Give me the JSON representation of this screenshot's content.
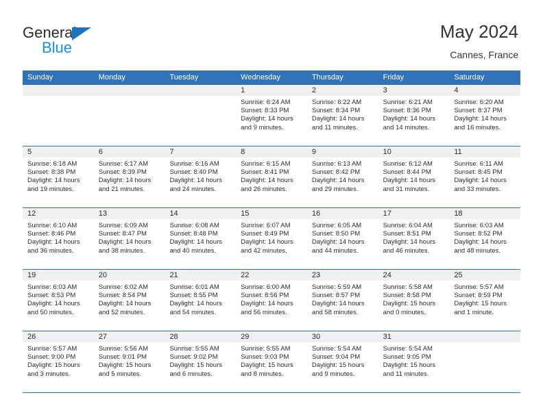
{
  "brand": {
    "name_part1": "General",
    "name_part2": "Blue"
  },
  "header": {
    "month_title": "May 2024",
    "location": "Cannes, France",
    "accent_color": "#3173b8",
    "band_color": "#f0f0f0"
  },
  "calendar": {
    "weekdays": [
      "Sunday",
      "Monday",
      "Tuesday",
      "Wednesday",
      "Thursday",
      "Friday",
      "Saturday"
    ],
    "weeks": [
      [
        {
          "day": "",
          "sunrise": "",
          "sunset": "",
          "daylight_line1": "",
          "daylight_line2": ""
        },
        {
          "day": "",
          "sunrise": "",
          "sunset": "",
          "daylight_line1": "",
          "daylight_line2": ""
        },
        {
          "day": "",
          "sunrise": "",
          "sunset": "",
          "daylight_line1": "",
          "daylight_line2": ""
        },
        {
          "day": "1",
          "sunrise": "Sunrise: 6:24 AM",
          "sunset": "Sunset: 8:33 PM",
          "daylight_line1": "Daylight: 14 hours",
          "daylight_line2": "and 9 minutes."
        },
        {
          "day": "2",
          "sunrise": "Sunrise: 6:22 AM",
          "sunset": "Sunset: 8:34 PM",
          "daylight_line1": "Daylight: 14 hours",
          "daylight_line2": "and 11 minutes."
        },
        {
          "day": "3",
          "sunrise": "Sunrise: 6:21 AM",
          "sunset": "Sunset: 8:36 PM",
          "daylight_line1": "Daylight: 14 hours",
          "daylight_line2": "and 14 minutes."
        },
        {
          "day": "4",
          "sunrise": "Sunrise: 6:20 AM",
          "sunset": "Sunset: 8:37 PM",
          "daylight_line1": "Daylight: 14 hours",
          "daylight_line2": "and 16 minutes."
        }
      ],
      [
        {
          "day": "5",
          "sunrise": "Sunrise: 6:18 AM",
          "sunset": "Sunset: 8:38 PM",
          "daylight_line1": "Daylight: 14 hours",
          "daylight_line2": "and 19 minutes."
        },
        {
          "day": "6",
          "sunrise": "Sunrise: 6:17 AM",
          "sunset": "Sunset: 8:39 PM",
          "daylight_line1": "Daylight: 14 hours",
          "daylight_line2": "and 21 minutes."
        },
        {
          "day": "7",
          "sunrise": "Sunrise: 6:16 AM",
          "sunset": "Sunset: 8:40 PM",
          "daylight_line1": "Daylight: 14 hours",
          "daylight_line2": "and 24 minutes."
        },
        {
          "day": "8",
          "sunrise": "Sunrise: 6:15 AM",
          "sunset": "Sunset: 8:41 PM",
          "daylight_line1": "Daylight: 14 hours",
          "daylight_line2": "and 26 minutes."
        },
        {
          "day": "9",
          "sunrise": "Sunrise: 6:13 AM",
          "sunset": "Sunset: 8:42 PM",
          "daylight_line1": "Daylight: 14 hours",
          "daylight_line2": "and 29 minutes."
        },
        {
          "day": "10",
          "sunrise": "Sunrise: 6:12 AM",
          "sunset": "Sunset: 8:44 PM",
          "daylight_line1": "Daylight: 14 hours",
          "daylight_line2": "and 31 minutes."
        },
        {
          "day": "11",
          "sunrise": "Sunrise: 6:11 AM",
          "sunset": "Sunset: 8:45 PM",
          "daylight_line1": "Daylight: 14 hours",
          "daylight_line2": "and 33 minutes."
        }
      ],
      [
        {
          "day": "12",
          "sunrise": "Sunrise: 6:10 AM",
          "sunset": "Sunset: 8:46 PM",
          "daylight_line1": "Daylight: 14 hours",
          "daylight_line2": "and 36 minutes."
        },
        {
          "day": "13",
          "sunrise": "Sunrise: 6:09 AM",
          "sunset": "Sunset: 8:47 PM",
          "daylight_line1": "Daylight: 14 hours",
          "daylight_line2": "and 38 minutes."
        },
        {
          "day": "14",
          "sunrise": "Sunrise: 6:08 AM",
          "sunset": "Sunset: 8:48 PM",
          "daylight_line1": "Daylight: 14 hours",
          "daylight_line2": "and 40 minutes."
        },
        {
          "day": "15",
          "sunrise": "Sunrise: 6:07 AM",
          "sunset": "Sunset: 8:49 PM",
          "daylight_line1": "Daylight: 14 hours",
          "daylight_line2": "and 42 minutes."
        },
        {
          "day": "16",
          "sunrise": "Sunrise: 6:05 AM",
          "sunset": "Sunset: 8:50 PM",
          "daylight_line1": "Daylight: 14 hours",
          "daylight_line2": "and 44 minutes."
        },
        {
          "day": "17",
          "sunrise": "Sunrise: 6:04 AM",
          "sunset": "Sunset: 8:51 PM",
          "daylight_line1": "Daylight: 14 hours",
          "daylight_line2": "and 46 minutes."
        },
        {
          "day": "18",
          "sunrise": "Sunrise: 6:03 AM",
          "sunset": "Sunset: 8:52 PM",
          "daylight_line1": "Daylight: 14 hours",
          "daylight_line2": "and 48 minutes."
        }
      ],
      [
        {
          "day": "19",
          "sunrise": "Sunrise: 6:03 AM",
          "sunset": "Sunset: 8:53 PM",
          "daylight_line1": "Daylight: 14 hours",
          "daylight_line2": "and 50 minutes."
        },
        {
          "day": "20",
          "sunrise": "Sunrise: 6:02 AM",
          "sunset": "Sunset: 8:54 PM",
          "daylight_line1": "Daylight: 14 hours",
          "daylight_line2": "and 52 minutes."
        },
        {
          "day": "21",
          "sunrise": "Sunrise: 6:01 AM",
          "sunset": "Sunset: 8:55 PM",
          "daylight_line1": "Daylight: 14 hours",
          "daylight_line2": "and 54 minutes."
        },
        {
          "day": "22",
          "sunrise": "Sunrise: 6:00 AM",
          "sunset": "Sunset: 8:56 PM",
          "daylight_line1": "Daylight: 14 hours",
          "daylight_line2": "and 56 minutes."
        },
        {
          "day": "23",
          "sunrise": "Sunrise: 5:59 AM",
          "sunset": "Sunset: 8:57 PM",
          "daylight_line1": "Daylight: 14 hours",
          "daylight_line2": "and 58 minutes."
        },
        {
          "day": "24",
          "sunrise": "Sunrise: 5:58 AM",
          "sunset": "Sunset: 8:58 PM",
          "daylight_line1": "Daylight: 15 hours",
          "daylight_line2": "and 0 minutes."
        },
        {
          "day": "25",
          "sunrise": "Sunrise: 5:57 AM",
          "sunset": "Sunset: 8:59 PM",
          "daylight_line1": "Daylight: 15 hours",
          "daylight_line2": "and 1 minute."
        }
      ],
      [
        {
          "day": "26",
          "sunrise": "Sunrise: 5:57 AM",
          "sunset": "Sunset: 9:00 PM",
          "daylight_line1": "Daylight: 15 hours",
          "daylight_line2": "and 3 minutes."
        },
        {
          "day": "27",
          "sunrise": "Sunrise: 5:56 AM",
          "sunset": "Sunset: 9:01 PM",
          "daylight_line1": "Daylight: 15 hours",
          "daylight_line2": "and 5 minutes."
        },
        {
          "day": "28",
          "sunrise": "Sunrise: 5:55 AM",
          "sunset": "Sunset: 9:02 PM",
          "daylight_line1": "Daylight: 15 hours",
          "daylight_line2": "and 6 minutes."
        },
        {
          "day": "29",
          "sunrise": "Sunrise: 5:55 AM",
          "sunset": "Sunset: 9:03 PM",
          "daylight_line1": "Daylight: 15 hours",
          "daylight_line2": "and 8 minutes."
        },
        {
          "day": "30",
          "sunrise": "Sunrise: 5:54 AM",
          "sunset": "Sunset: 9:04 PM",
          "daylight_line1": "Daylight: 15 hours",
          "daylight_line2": "and 9 minutes."
        },
        {
          "day": "31",
          "sunrise": "Sunrise: 5:54 AM",
          "sunset": "Sunset: 9:05 PM",
          "daylight_line1": "Daylight: 15 hours",
          "daylight_line2": "and 11 minutes."
        },
        {
          "day": "",
          "sunrise": "",
          "sunset": "",
          "daylight_line1": "",
          "daylight_line2": ""
        }
      ]
    ]
  }
}
